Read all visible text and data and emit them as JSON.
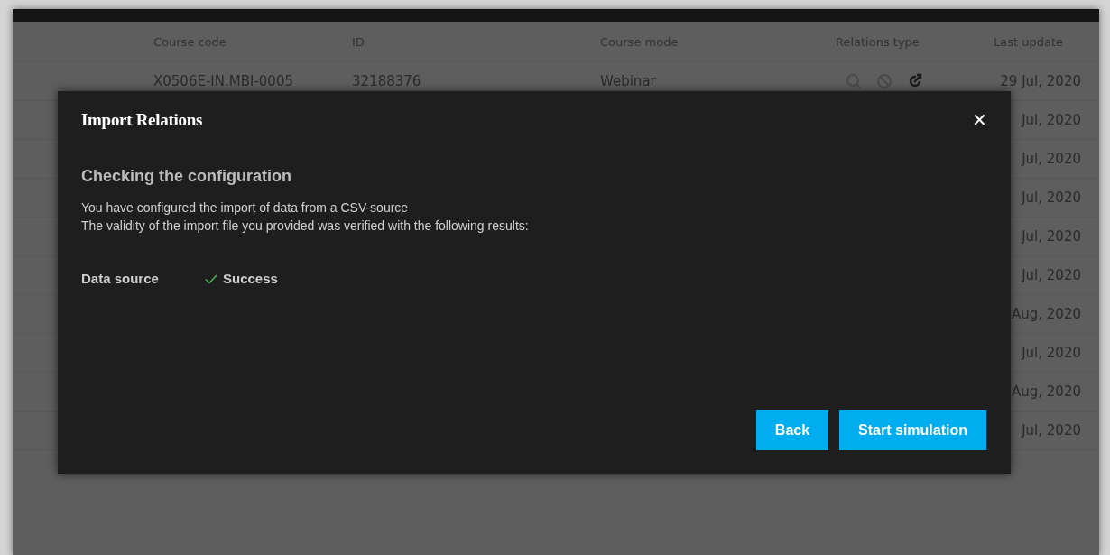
{
  "table": {
    "columns": [
      "Course code",
      "ID",
      "Course mode",
      "Relations type",
      "Last update"
    ],
    "rows": [
      {
        "course_code": "X0506E-IN.MBI-0005",
        "id": "32188376",
        "course_mode": "Webinar",
        "relations": [
          {
            "kind": "search",
            "on": false
          },
          {
            "kind": "blocked",
            "on": false
          },
          {
            "kind": "linked",
            "on": true
          }
        ],
        "last_update": "29 Jul, 2020"
      },
      {
        "last_update": "Jul, 2020"
      },
      {
        "last_update": "Jul, 2020"
      },
      {
        "last_update": "Jul, 2020"
      },
      {
        "last_update": "Jul, 2020"
      },
      {
        "last_update": "Jul, 2020"
      },
      {
        "last_update": "Aug, 2020"
      },
      {
        "last_update": "Jul, 2020"
      },
      {
        "last_update": "Aug, 2020"
      },
      {
        "last_update": "Jul, 2020"
      }
    ]
  },
  "dialog": {
    "title": "Import Relations",
    "close": "✕",
    "heading": "Checking the configuration",
    "message": [
      "You have configured the import of data from a CSV-source",
      "The validity of the import file you provided was verified with the following results:"
    ],
    "results": [
      {
        "label": "Data source",
        "success": true,
        "value": "Success"
      }
    ],
    "buttons": [
      "Back",
      "Start simulation"
    ]
  }
}
